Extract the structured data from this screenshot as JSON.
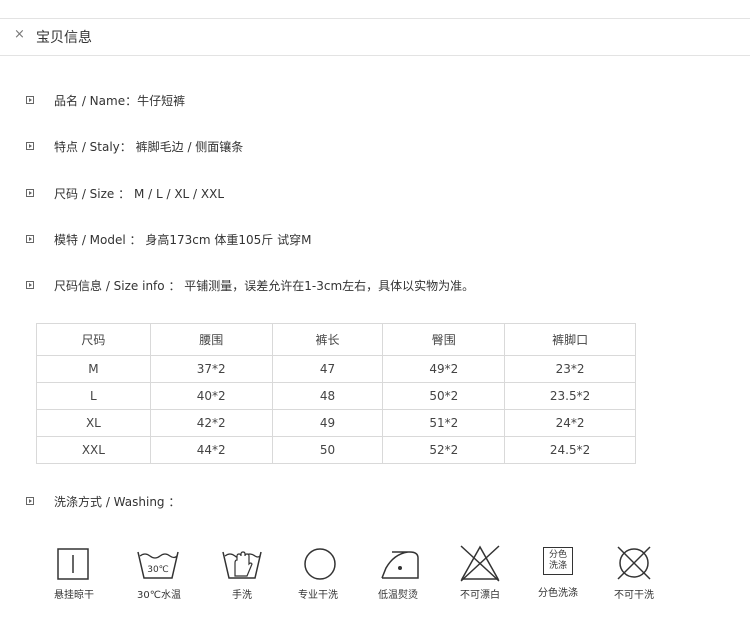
{
  "header": {
    "close_symbol": "×",
    "title": "宝贝信息"
  },
  "info": [
    {
      "label": "品名 / Name：",
      "value": "牛仔短裤"
    },
    {
      "label": "特点 / Staly：",
      "value": "裤脚毛边 / 侧面镶条"
    },
    {
      "label": "尺码 / Size ：",
      "value": "M / L / XL / XXL"
    },
    {
      "label": "模特 / Model ：",
      "value": "身高173cm  体重105斤  试穿M"
    },
    {
      "label": "尺码信息 / Size info ：",
      "value": "平铺测量，误差允许在1-3cm左右，具体以实物为准。"
    }
  ],
  "size_table": {
    "headers": [
      "尺码",
      "腰围",
      "裤长",
      "臀围",
      "裤脚口"
    ],
    "rows": [
      [
        "M",
        "37*2",
        "47",
        "49*2",
        "23*2"
      ],
      [
        "L",
        "40*2",
        "48",
        "50*2",
        "23.5*2"
      ],
      [
        "XL",
        "42*2",
        "49",
        "51*2",
        "24*2"
      ],
      [
        "XXL",
        "44*2",
        "50",
        "52*2",
        "24.5*2"
      ]
    ]
  },
  "washing": {
    "label": "洗涤方式 / Washing ：",
    "icons": [
      {
        "name": "hang-dry-icon",
        "label": "悬挂晾干"
      },
      {
        "name": "wash-30c-icon",
        "label": "30℃水温",
        "glyph": "30℃"
      },
      {
        "name": "hand-wash-icon",
        "label": "手洗"
      },
      {
        "name": "professional-dry-clean-icon",
        "label": "专业干洗"
      },
      {
        "name": "low-temp-iron-icon",
        "label": "低温熨烫"
      },
      {
        "name": "no-bleach-icon",
        "label": "不可漂白"
      },
      {
        "name": "separate-wash-icon",
        "label": "分色洗涤",
        "glyph_line1": "分色",
        "glyph_line2": "洗涤"
      },
      {
        "name": "no-dry-clean-icon",
        "label": "不可干洗"
      }
    ]
  }
}
